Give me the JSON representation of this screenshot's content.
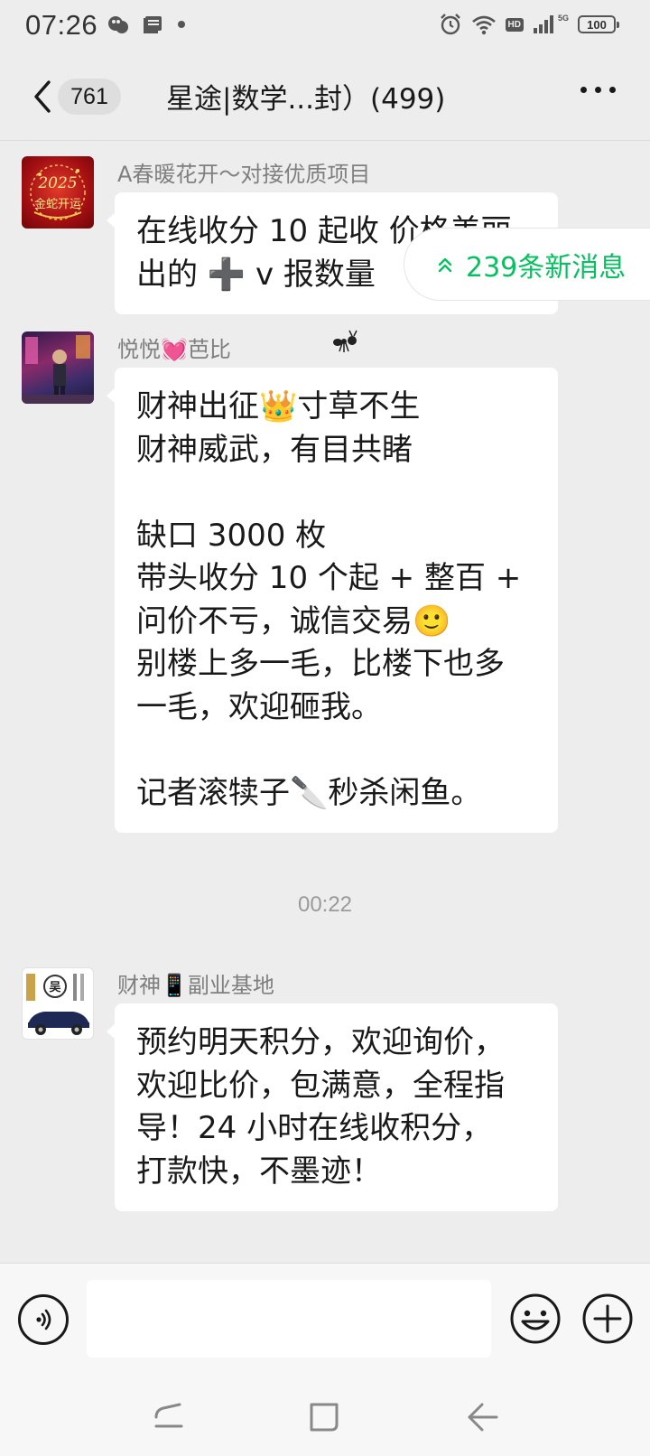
{
  "status_bar": {
    "time": "07:26",
    "battery": "100",
    "hd": "HD",
    "net": "5G"
  },
  "header": {
    "unread_count": "761",
    "title": "星途|数学...封）(499)"
  },
  "new_messages_pill": "239条新消息",
  "messages": [
    {
      "sender": "A春暖花开～对接优质项目",
      "avatar_text": [
        "2025",
        "金蛇开运"
      ],
      "lines": [
        "在线收分 10 起收 价格美丽",
        "出的 ➕ v 报数量"
      ]
    },
    {
      "sender": "悦悦💓芭比",
      "lines": [
        "财神出征👑寸草不生",
        "财神威武，有目共睹",
        "",
        "缺口 3000 枚",
        "带头收分 10 个起 + 整百 +",
        "问价不亏，诚信交易🙂",
        "别楼上多一毛，比楼下也多",
        "一毛，欢迎砸我。",
        "",
        "记者滚犊子🔪秒杀闲鱼。"
      ]
    },
    {
      "sender": "财神📱副业基地",
      "avatar_text": [
        "吴"
      ],
      "lines": [
        "预约明天积分，欢迎询价，",
        "欢迎比价，包满意，全程指",
        "导！24 小时在线收积分，",
        "打款快，不墨迹！"
      ]
    }
  ],
  "timestamp": "00:22",
  "colors": {
    "accent": "#07c160",
    "background": "#ededed",
    "bubble": "#ffffff",
    "sender": "#7f7f7f"
  },
  "icons": {
    "back": "chevron-left-icon",
    "more": "more-dots-icon",
    "voice": "voice-icon",
    "emoji": "emoji-icon",
    "plus": "plus-icon",
    "new_msg": "double-chevron-up-icon"
  }
}
